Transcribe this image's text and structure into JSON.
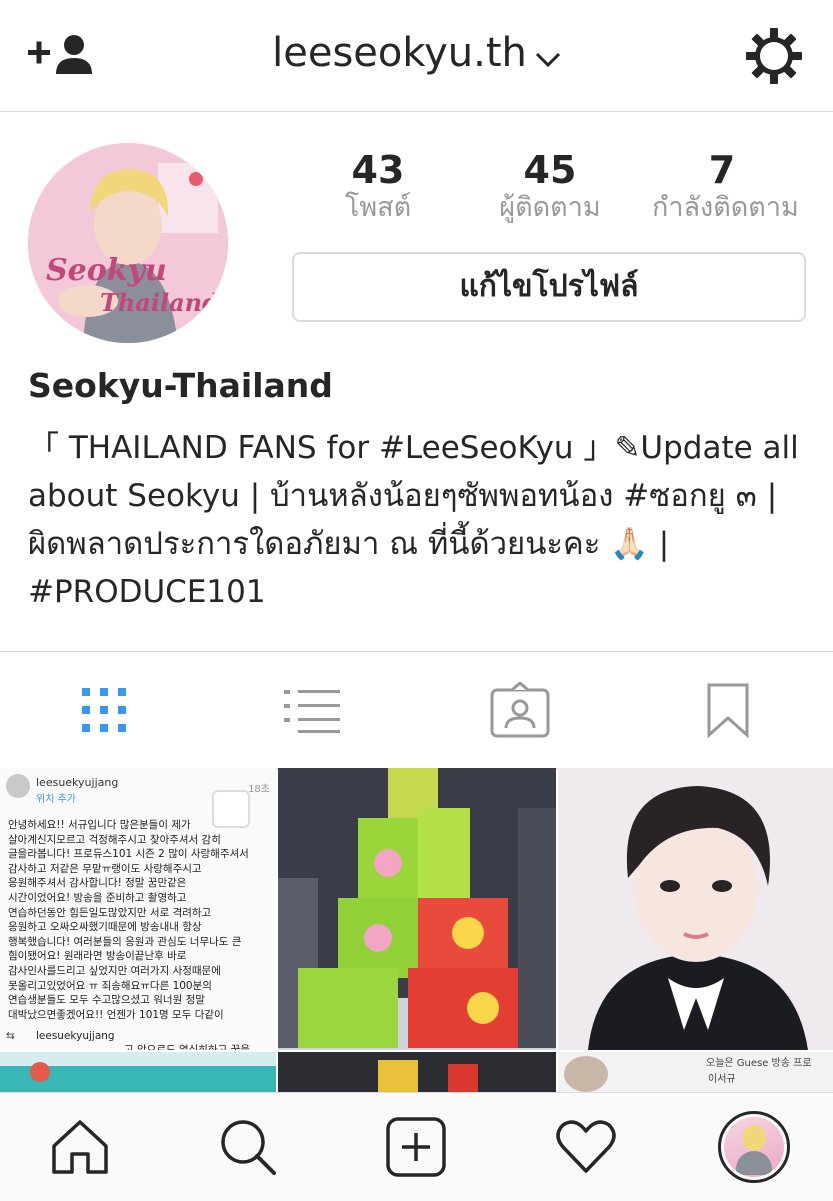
{
  "header": {
    "username": "leeseokyu.th",
    "add_person_icon": "add-person-icon",
    "settings_icon": "gear-icon"
  },
  "profile": {
    "avatar_text_1": "Seokyu",
    "avatar_text_2": "Thailand",
    "stats": [
      {
        "value": "43",
        "label": "โพสต์"
      },
      {
        "value": "45",
        "label": "ผู้ติดตาม"
      },
      {
        "value": "7",
        "label": "กำลังติดตาม"
      }
    ],
    "edit_button": "แก้ไขโปรไฟล์",
    "display_name": "Seokyu-Thailand",
    "bio": "「 THAILAND FANS for #LeeSeoKyu 」✎Update all about Seokyu | บ้านหลังน้อยๆซัพพอทน้อง #ซอกยู ๓ | ผิดพลาดประการใดอภัยมา ณ ที่นี้ด้วยนะคะ 🙏🏻 | #PRODUCE101"
  },
  "tabs": [
    "grid-icon",
    "list-icon",
    "tagged-icon",
    "bookmark-icon"
  ],
  "posts": {
    "first": {
      "user": "leesuekyujjang",
      "location": "위치 추가",
      "time": "18초",
      "text": "안녕하세요!! 서규입니다 많은분들이 제가 \n살아계신지모르고 걱정해주시고 찾아주셔서 감히\n글을라봅니다! 프로듀스101 시즌 2 많이 사랑해주셔서\n감사하고 저같은 무맡ㅠ랭이도 사랑해주시고\n응원해주셔서 감사합니다! 정말 꿈만같은\n시간이었어요! 방송을 준비하고 촬영하고\n연습하던동안 힘든일도많았지만 서로 격려하고\n응원하고 오싸오싸했기때문에 방송내내 항상\n행복했습니다! 여러분들의 응원과 관심도 너무나도 큰\n힘이됐어요! 원래라면 방송이끝난후 바로\n감사인사를드리고 싶었지만 여러가지 사정때문에\n못올리고있었어요 ㅠ 죄송해요ㅠ다른 100분의\n연습생분들도 모두 수고많으셨고 워너원 정말\n대박났으면좋겠어요!! 언젠가 101명 모두 다같이",
      "comment_user": "leesuekyujjang",
      "comment_text": "고 앞으로도 열심히하고 꿈을"
    },
    "sixth_text_1": "오늘은 Guese 방송 프로",
    "sixth_text_2": "이서규"
  },
  "bottom_nav": [
    "home-icon",
    "search-icon",
    "new-post-icon",
    "heart-icon",
    "profile-avatar"
  ],
  "colors": {
    "accent_blue": "#3897f0",
    "border": "#dbdbdb",
    "muted": "#999999",
    "text": "#262626"
  }
}
